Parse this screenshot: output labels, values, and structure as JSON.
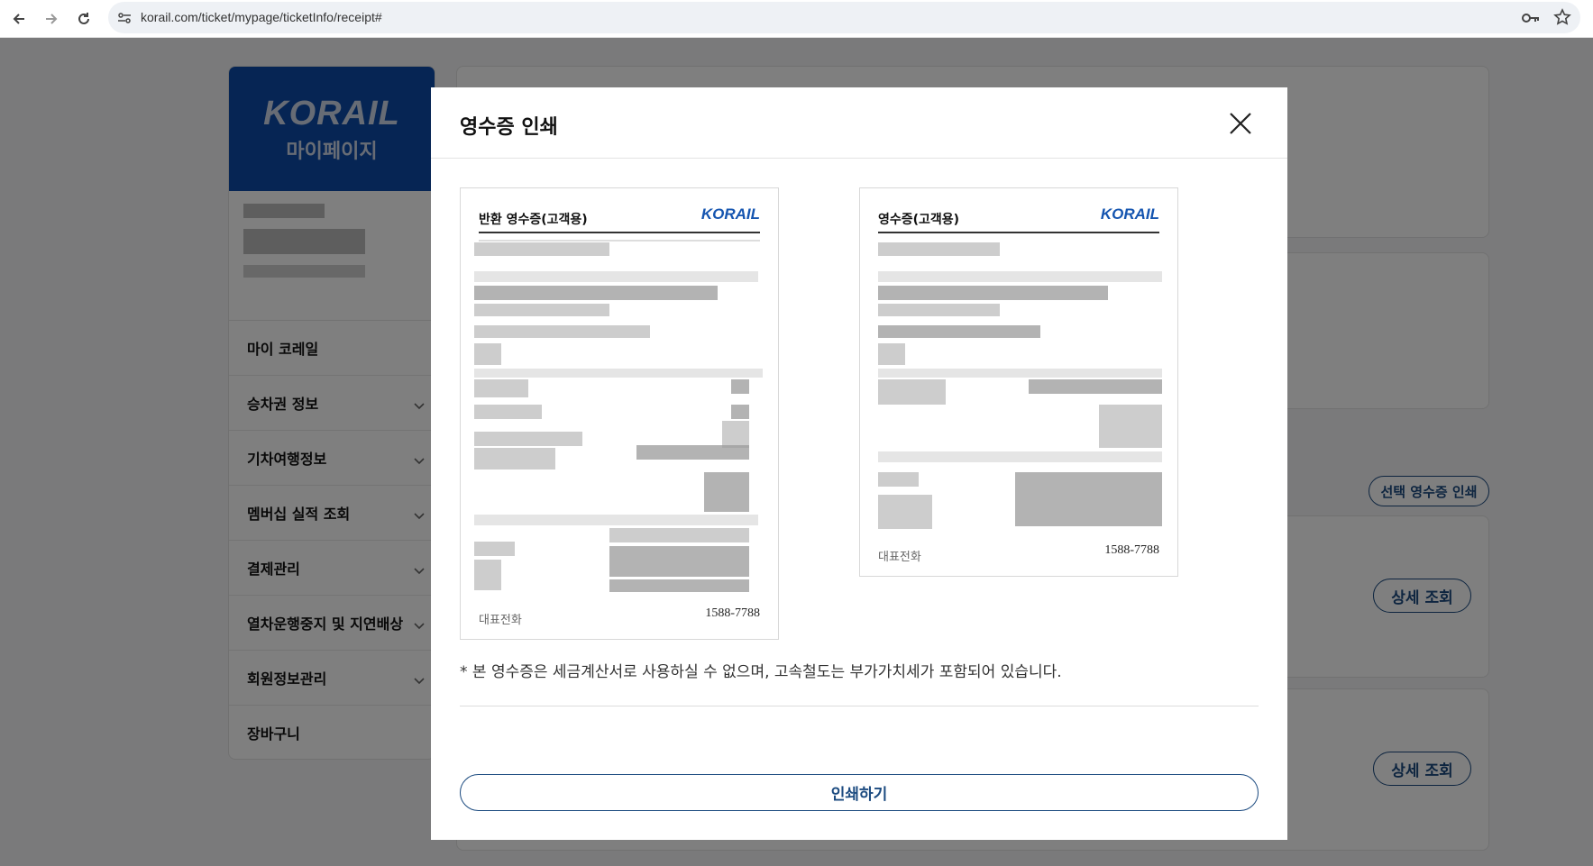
{
  "browser": {
    "url": "korail.com/ticket/mypage/ticketInfo/receipt#",
    "icons": [
      "back-arrow-icon",
      "forward-arrow-icon",
      "reload-icon",
      "site-settings-icon",
      "password-key-icon",
      "bookmark-star-icon"
    ]
  },
  "sidebar": {
    "logo": "KORAIL",
    "title": "마이페이지",
    "items": [
      {
        "label": "마이 코레일",
        "has_chevron": false
      },
      {
        "label": "승차권 정보",
        "has_chevron": true
      },
      {
        "label": "기차여행정보",
        "has_chevron": true
      },
      {
        "label": "멤버십 실적 조회",
        "has_chevron": true
      },
      {
        "label": "결제관리",
        "has_chevron": true
      },
      {
        "label": "열차운행중지 및 지연배상",
        "has_chevron": true
      },
      {
        "label": "회원정보관리",
        "has_chevron": true
      },
      {
        "label": "장바구니",
        "has_chevron": false
      }
    ]
  },
  "main": {
    "select_print_label": "선택 영수증 인쇄",
    "detail_labels": [
      "상세 조회",
      "상세 조회"
    ]
  },
  "modal": {
    "title": "영수증 인쇄",
    "receipts": [
      {
        "title": "반환 영수증(고객용)",
        "logo": "KORAIL",
        "footer_label": "대표전화",
        "phone": "1588-7788"
      },
      {
        "title": "영수증(고객용)",
        "logo": "KORAIL",
        "footer_label": "대표전화",
        "phone": "1588-7788"
      }
    ],
    "notice": "* 본 영수증은 세금계산서로 사용하실 수 없으며, 고속철도는 부가가치세가 포함되어 있습니다.",
    "print_label": "인쇄하기"
  },
  "colors": {
    "brand_blue": "#0d4aa8",
    "button_navy": "#1c4b80",
    "overlay": "rgba(0,0,0,0.5)"
  }
}
